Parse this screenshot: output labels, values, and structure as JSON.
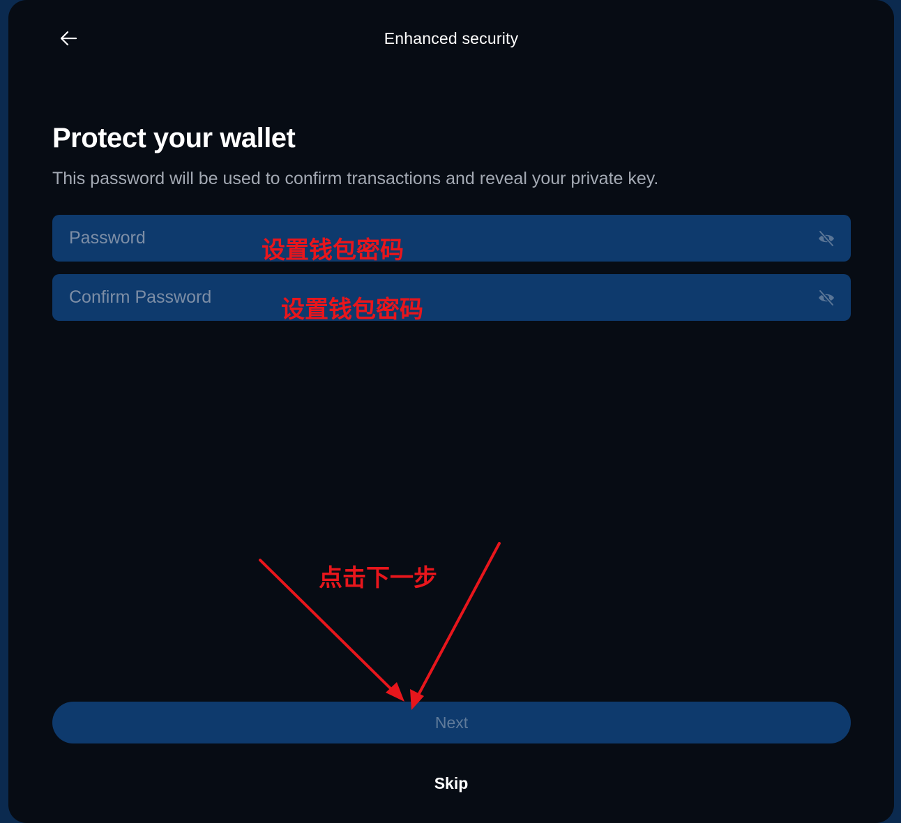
{
  "header": {
    "title": "Enhanced security",
    "back_icon": "arrow-left-icon"
  },
  "main": {
    "title": "Protect your wallet",
    "subtitle": "This password will be used to confirm transactions and reveal your private key.",
    "password_field": {
      "placeholder": "Password",
      "value": "",
      "icon": "eye-off-icon"
    },
    "confirm_field": {
      "placeholder": "Confirm Password",
      "value": "",
      "icon": "eye-off-icon"
    }
  },
  "footer": {
    "next_label": "Next",
    "skip_label": "Skip"
  },
  "annotations": {
    "password_note": "设置钱包密码",
    "confirm_note": "设置钱包密码",
    "next_note": "点击下一步"
  },
  "colors": {
    "page_background": "#0b2a4f",
    "panel_background": "#070c14",
    "field_background": "#0e3a6d",
    "annotation_red": "#e8161c"
  }
}
